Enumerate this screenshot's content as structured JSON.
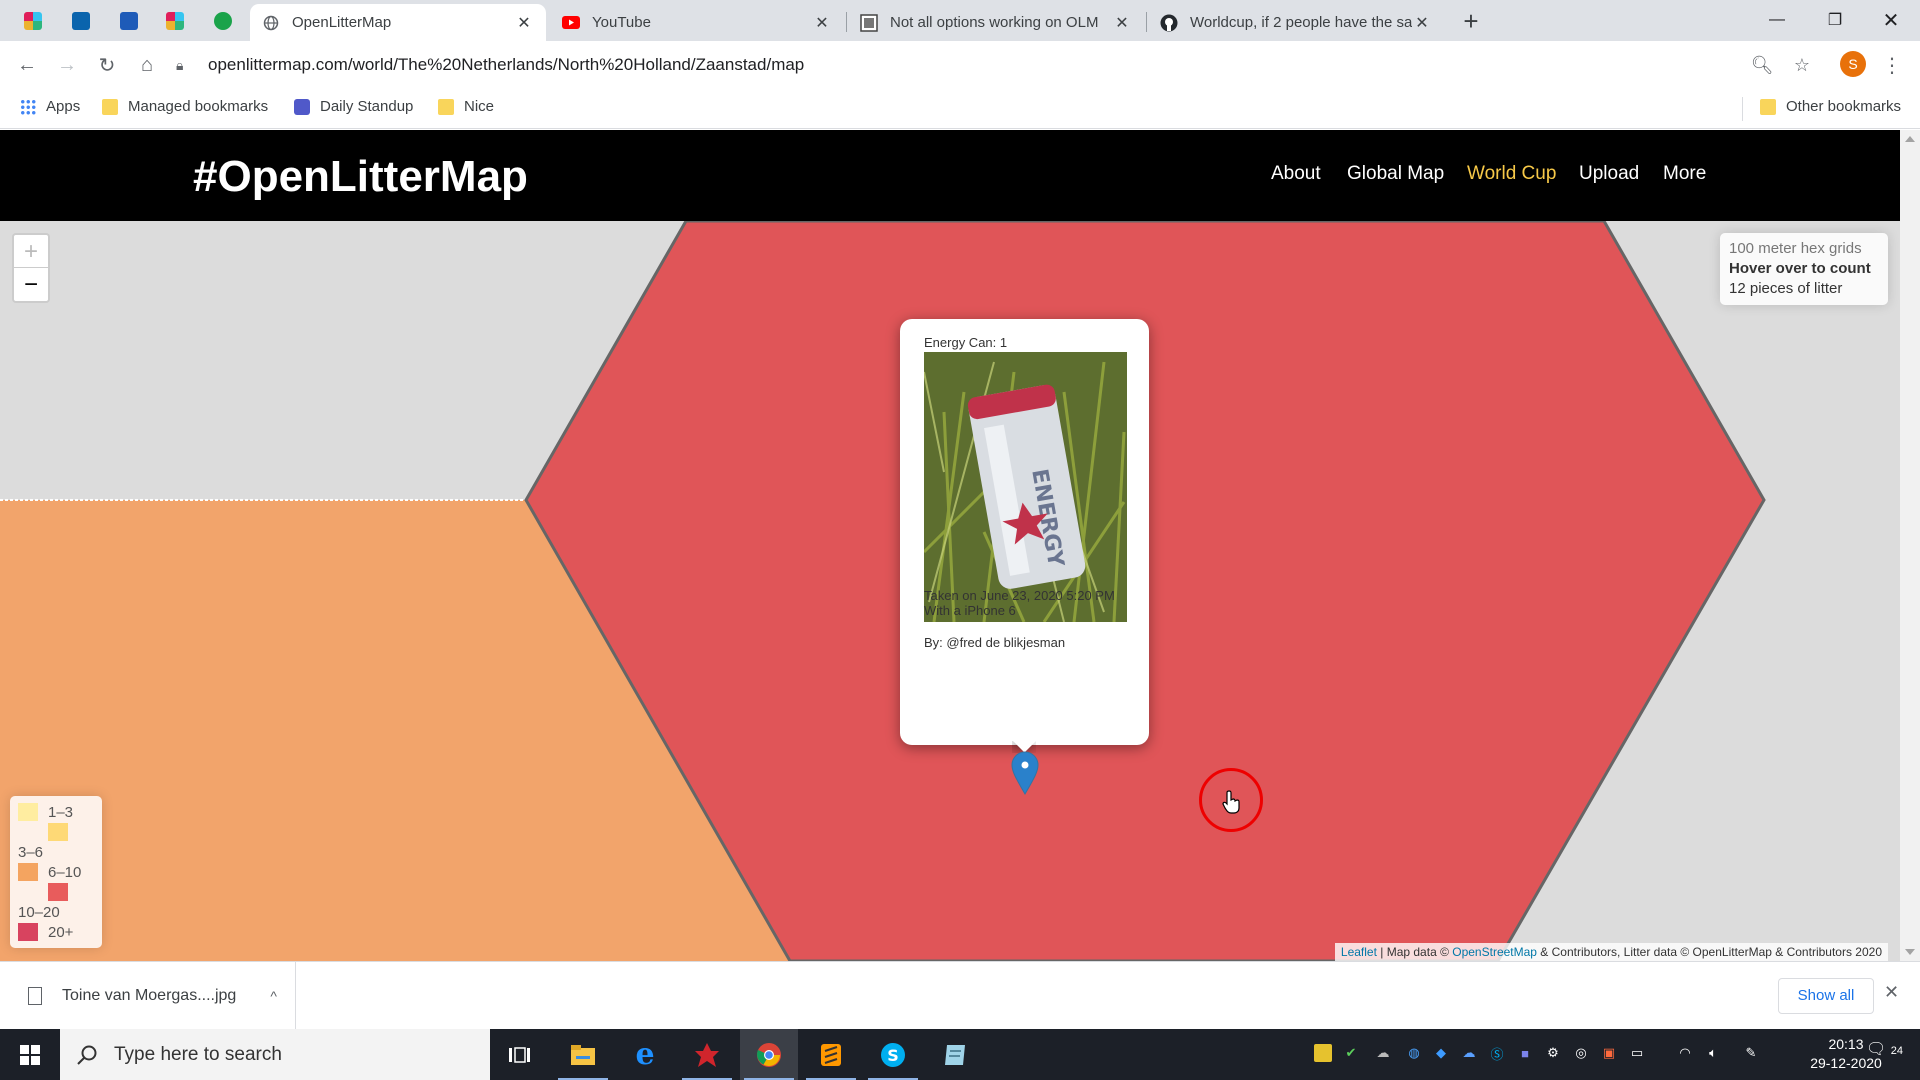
{
  "browser": {
    "tabs": [
      {
        "title": "OpenLitterMap",
        "active": true,
        "icon": "globe-icon"
      },
      {
        "title": "YouTube",
        "active": false,
        "icon": "youtube-icon"
      },
      {
        "title": "Not all options working on OLM",
        "active": false,
        "icon": "page-icon"
      },
      {
        "title": "Worldcup, if 2 people have the sa",
        "active": false,
        "icon": "github-icon"
      }
    ],
    "pinned_tabs": [
      "slack-icon",
      "outlook-icon",
      "word-icon",
      "slack-icon",
      "app-1-icon"
    ],
    "url": "openlittermap.com/world/The%20Netherlands/North%20Holland/Zaanstad/map",
    "profile_initial": "S",
    "bookmarks": [
      {
        "label": "Apps",
        "icon": "apps-grid-icon"
      },
      {
        "label": "Managed bookmarks",
        "icon": "folder-icon"
      },
      {
        "label": "Daily Standup",
        "icon": "teams-icon"
      },
      {
        "label": "Nice",
        "icon": "folder-icon"
      }
    ],
    "other_bookmarks": "Other bookmarks"
  },
  "site": {
    "logo": "#OpenLitterMap",
    "nav": [
      {
        "label": "About",
        "active": false
      },
      {
        "label": "Global Map",
        "active": false
      },
      {
        "label": "World Cup",
        "active": true
      },
      {
        "label": "Upload",
        "active": false
      },
      {
        "label": "More",
        "active": false
      }
    ],
    "accent_color": "#f7c948"
  },
  "map": {
    "zoom_in": "+",
    "zoom_out": "−",
    "info": {
      "grid_label": "100 meter hex grids",
      "hover_label": "Hover over to count",
      "count_label": "12 pieces of litter"
    },
    "legend": [
      {
        "label": "1–3",
        "color": "#ffeda0"
      },
      {
        "label": "3–6",
        "color": "#fed976"
      },
      {
        "label": "6–10",
        "color": "#f4a460"
      },
      {
        "label": "10–20",
        "color": "#e85c5c"
      },
      {
        "label": "20+",
        "color": "#d8435f"
      }
    ],
    "hex_colors": {
      "main": "#e05558",
      "left": "#f2a46b",
      "background": "#dcdcdc",
      "outline": "#666666"
    },
    "popup": {
      "title": "Energy Can: 1",
      "taken": "Taken on June 23, 2020 5:20 PM",
      "device": "With a iPhone 6",
      "by": "By: @fred de blikjesman"
    },
    "attribution": {
      "leaflet": "Leaflet",
      "map_data": " | Map data © ",
      "osm": "OpenStreetMap",
      "rest": " & Contributors, Litter data © OpenLitterMap & Contributors 2020"
    }
  },
  "downloads": {
    "file": "Toine van Moergas....jpg",
    "show_all": "Show all"
  },
  "taskbar": {
    "search_placeholder": "Type here to search",
    "time": "20:13",
    "date": "29-12-2020",
    "notifications": "24"
  }
}
